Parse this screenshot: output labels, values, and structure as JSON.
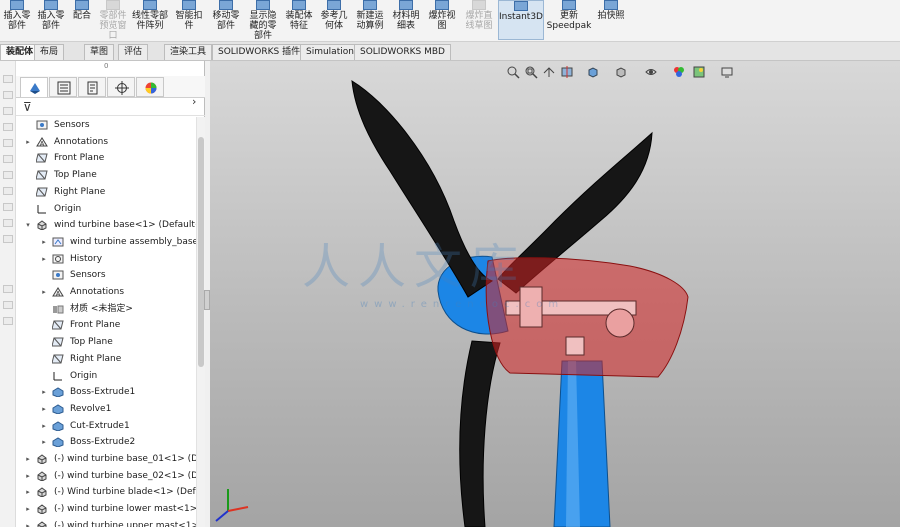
{
  "ribbon": {
    "buttons": [
      {
        "label": "插入零\n部件",
        "disabled": false
      },
      {
        "label": "插入零\n部件",
        "disabled": false
      },
      {
        "label": "配合",
        "disabled": false
      },
      {
        "label": "零部件\n预览窗\n口",
        "disabled": true
      },
      {
        "label": "线性零部\n件阵列",
        "disabled": false
      },
      {
        "label": "智能扣\n件",
        "disabled": false
      },
      {
        "label": "移动零\n部件",
        "disabled": false
      },
      {
        "label": "显示隐\n藏的零\n部件",
        "disabled": false
      },
      {
        "label": "装配体\n特征",
        "disabled": false
      },
      {
        "label": "参考几\n何体",
        "disabled": false
      },
      {
        "label": "新建运\n动算例",
        "disabled": false
      },
      {
        "label": "材料明\n细表",
        "disabled": false
      },
      {
        "label": "爆炸视\n图",
        "disabled": false
      },
      {
        "label": "爆炸直\n线草图",
        "disabled": true
      },
      {
        "label": "Instant3D",
        "disabled": false
      },
      {
        "label": "更新\nSpeedpak",
        "disabled": false
      },
      {
        "label": "拍快照",
        "disabled": false
      }
    ]
  },
  "tabs": [
    "装配体",
    "布局",
    "草图",
    "评估",
    "渲染工具",
    "SOLIDWORKS 插件",
    "Simulation",
    "SOLIDWORKS MBD"
  ],
  "feature_manager": {
    "handle": "0",
    "tree": [
      {
        "label": "Sensors",
        "icon": "sensor-icon",
        "depth": 0,
        "expander": ""
      },
      {
        "label": "Annotations",
        "icon": "annotation-icon",
        "depth": 0,
        "expander": "▸"
      },
      {
        "label": "Front Plane",
        "icon": "plane-icon",
        "depth": 0,
        "expander": ""
      },
      {
        "label": "Top Plane",
        "icon": "plane-icon",
        "depth": 0,
        "expander": ""
      },
      {
        "label": "Right Plane",
        "icon": "plane-icon",
        "depth": 0,
        "expander": ""
      },
      {
        "label": "Origin",
        "icon": "origin-icon",
        "depth": 0,
        "expander": ""
      },
      {
        "label": "wind turbine base<1> (Default<",
        "icon": "part-icon",
        "depth": 0,
        "expander": "▾"
      },
      {
        "label": "wind turbine assembly_base",
        "icon": "reference-icon",
        "depth": 1,
        "expander": "▸"
      },
      {
        "label": "History",
        "icon": "history-icon",
        "depth": 1,
        "expander": "▸"
      },
      {
        "label": "Sensors",
        "icon": "sensor-icon",
        "depth": 1,
        "expander": ""
      },
      {
        "label": "Annotations",
        "icon": "annotation-icon",
        "depth": 1,
        "expander": "▸"
      },
      {
        "label": "材质 <未指定>",
        "icon": "material-icon",
        "depth": 1,
        "expander": ""
      },
      {
        "label": "Front Plane",
        "icon": "plane-icon",
        "depth": 1,
        "expander": ""
      },
      {
        "label": "Top Plane",
        "icon": "plane-icon",
        "depth": 1,
        "expander": ""
      },
      {
        "label": "Right Plane",
        "icon": "plane-icon",
        "depth": 1,
        "expander": ""
      },
      {
        "label": "Origin",
        "icon": "origin-icon",
        "depth": 1,
        "expander": ""
      },
      {
        "label": "Boss-Extrude1",
        "icon": "feature-icon",
        "depth": 1,
        "expander": "▸"
      },
      {
        "label": "Revolve1",
        "icon": "feature-icon",
        "depth": 1,
        "expander": "▸"
      },
      {
        "label": "Cut-Extrude1",
        "icon": "feature-icon",
        "depth": 1,
        "expander": "▸"
      },
      {
        "label": "Boss-Extrude2",
        "icon": "feature-icon",
        "depth": 1,
        "expander": "▸"
      },
      {
        "label": "(-) wind turbine base_01<1> (D",
        "icon": "part-icon",
        "depth": 0,
        "expander": "▸"
      },
      {
        "label": "(-) wind turbine base_02<1> (D",
        "icon": "part-icon",
        "depth": 0,
        "expander": "▸"
      },
      {
        "label": "(-) Wind turbine blade<1> (Def",
        "icon": "part-icon",
        "depth": 0,
        "expander": "▸"
      },
      {
        "label": "(-) wind turbine lower mast<1>",
        "icon": "part-icon",
        "depth": 0,
        "expander": "▸"
      },
      {
        "label": "(-) wind turbine upper mast<1>",
        "icon": "part-icon",
        "depth": 0,
        "expander": "▸"
      }
    ]
  },
  "watermark": {
    "text": "人人文库",
    "url": "www.renrendoc.com"
  },
  "colors": {
    "blade": "#161616",
    "mast": "#1c86e6",
    "nacelle": "#d42424",
    "viewport_top": "#d8d8d8",
    "viewport_bottom": "#a4a4a4"
  }
}
